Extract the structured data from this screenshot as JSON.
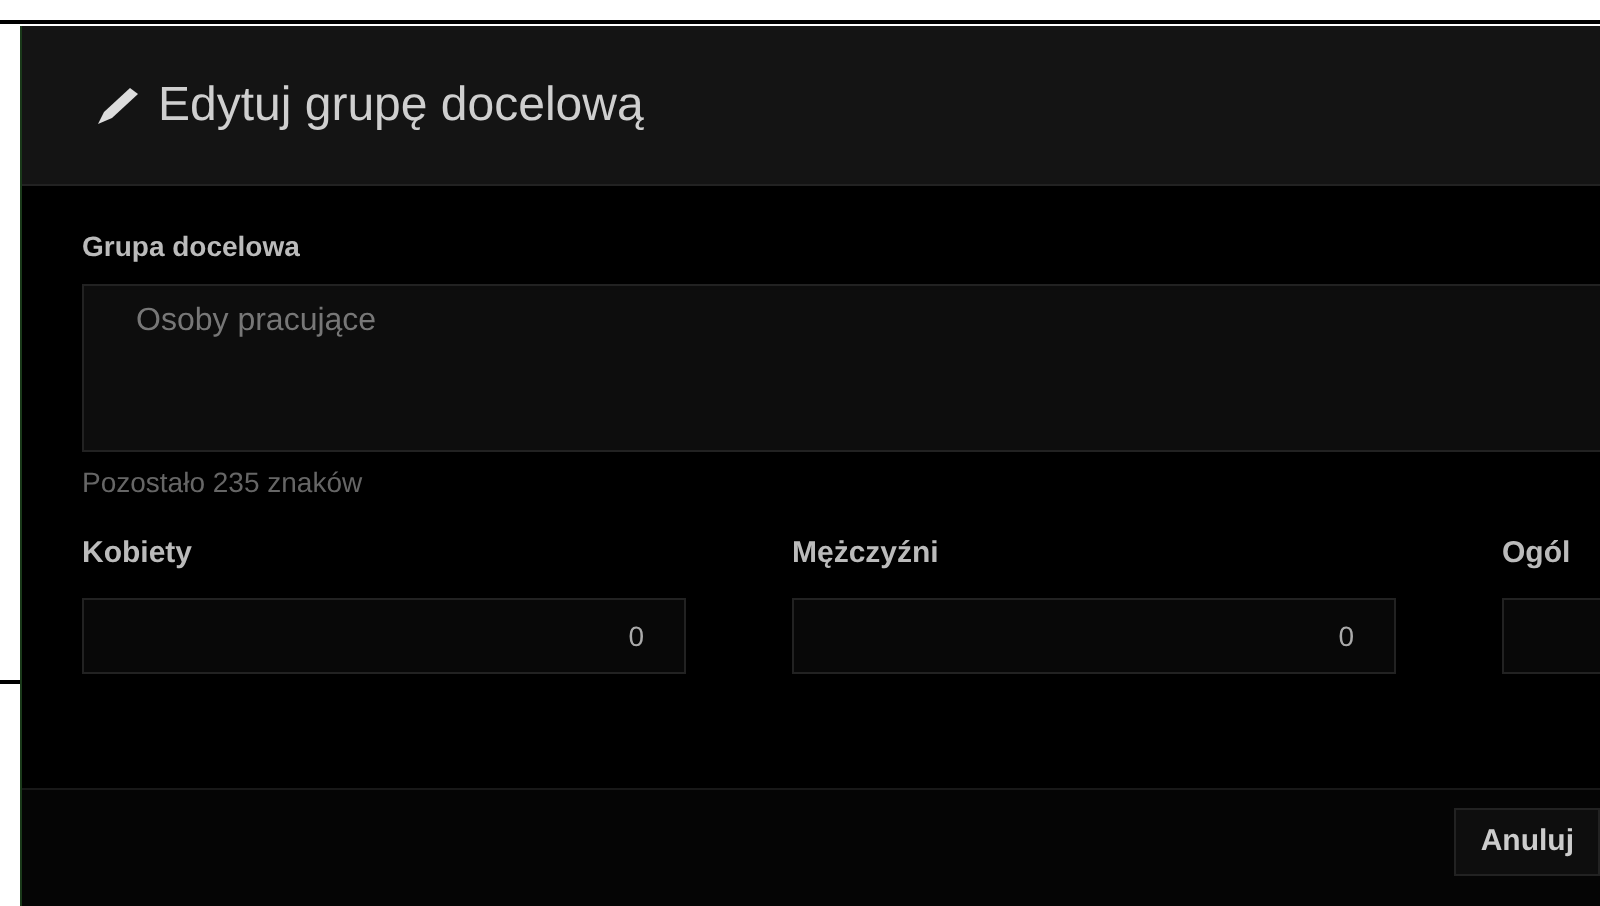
{
  "dialog": {
    "title": "Edytuj grupę docelową",
    "group_label": "Grupa docelowa",
    "group_value": "Osoby pracujące",
    "remaining": "Pozostało 235 znaków",
    "counts": [
      {
        "label": "Kobiety",
        "value": "0"
      },
      {
        "label": "Mężczyźni",
        "value": "0"
      },
      {
        "label": "Ogól"
      }
    ],
    "buttons": [
      "Anuluj"
    ]
  }
}
